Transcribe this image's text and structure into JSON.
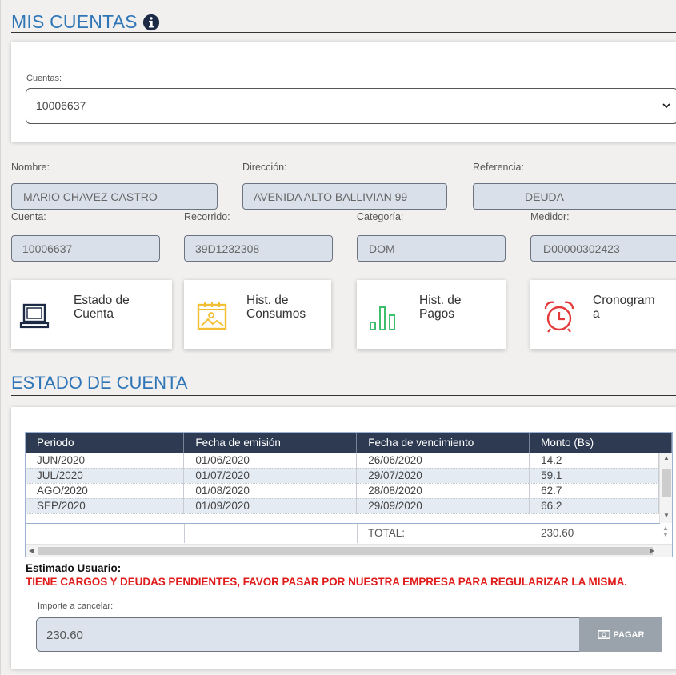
{
  "header": {
    "title": "MIS CUENTAS"
  },
  "account_select": {
    "label": "Cuentas:",
    "value": "10006637"
  },
  "fields": {
    "nombre": {
      "label": "Nombre:",
      "value": "MARIO CHAVEZ CASTRO"
    },
    "direccion": {
      "label": "Dirección:",
      "value": "AVENIDA ALTO BALLIVIAN 99"
    },
    "referencia": {
      "label": "Referencia:",
      "value": "DEUDA"
    },
    "cuenta": {
      "label": "Cuenta:",
      "value": "10006637"
    },
    "recorrido": {
      "label": "Recorrido:",
      "value": "39D1232308"
    },
    "categoria": {
      "label": "Categoría:",
      "value": "DOM"
    },
    "medidor": {
      "label": "Medidor:",
      "value": "D00000302423"
    }
  },
  "tiles": [
    {
      "line1": "Estado de",
      "line2": "Cuenta",
      "icon": "laptop-icon"
    },
    {
      "line1": "Hist. de",
      "line2": "Consumos",
      "icon": "image-icon"
    },
    {
      "line1": "Hist. de",
      "line2": "Pagos",
      "icon": "bar-chart-icon"
    },
    {
      "line1": "Cronogram",
      "line2": "a",
      "icon": "alarm-clock-icon"
    }
  ],
  "estado": {
    "title": "ESTADO DE CUENTA",
    "columns": [
      "Periodo",
      "Fecha de emisión",
      "Fecha de vencimiento",
      "Monto (Bs)"
    ],
    "rows": [
      [
        "JUN/2020",
        "01/06/2020",
        "26/06/2020",
        "14.2"
      ],
      [
        "JUL/2020",
        "01/07/2020",
        "29/07/2020",
        "59.1"
      ],
      [
        "AGO/2020",
        "01/08/2020",
        "28/08/2020",
        "62.7"
      ],
      [
        "SEP/2020",
        "01/09/2020",
        "29/09/2020",
        "66.2"
      ]
    ],
    "total_label": "TOTAL:",
    "total_value": "230.60"
  },
  "message": {
    "title": "Estimado Usuario:",
    "body": "TIENE CARGOS Y DEUDAS PENDIENTES, FAVOR PASAR POR NUESTRA EMPRESA PARA REGULARIZAR LA MISMA."
  },
  "payment": {
    "label": "Importe a cancelar:",
    "value": "230.60",
    "button": "PAGAR"
  },
  "colors": {
    "accent": "#2f76b8",
    "header_bg": "#2d3a52",
    "alert": "#e01b1b"
  }
}
